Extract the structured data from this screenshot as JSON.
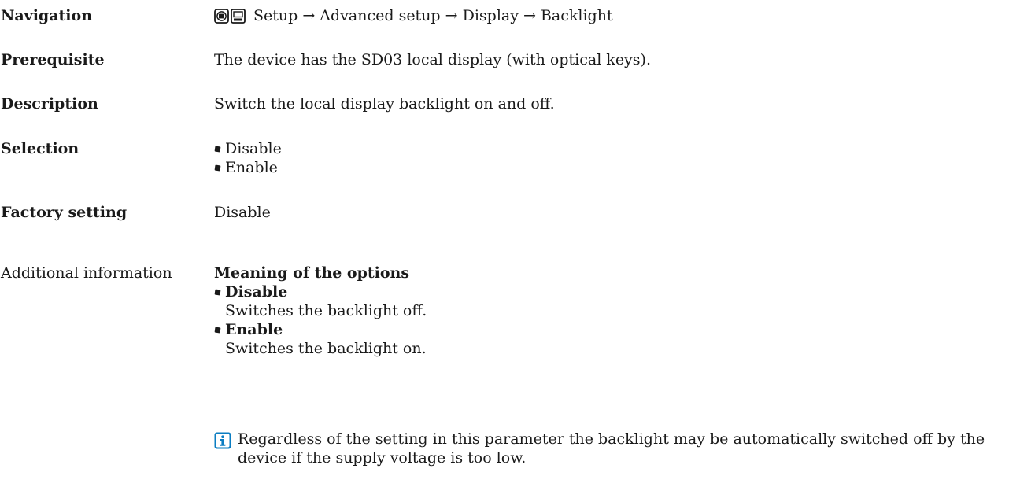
{
  "rows": {
    "navigation": {
      "label": "Navigation",
      "path": "Setup → Advanced setup → Display → Backlight",
      "icons": [
        "display-operation-icon",
        "operating-tool-icon"
      ]
    },
    "prerequisite": {
      "label": "Prerequisite",
      "text": "The device has the SD03 local display (with optical keys)."
    },
    "description": {
      "label": "Description",
      "text": "Switch the local display backlight on and off."
    },
    "selection": {
      "label": "Selection",
      "options": [
        "Disable",
        "Enable"
      ]
    },
    "factory_setting": {
      "label": "Factory setting",
      "value": "Disable"
    },
    "additional_information": {
      "label": "Additional information",
      "heading": "Meaning of the options",
      "options": [
        {
          "name": "Disable",
          "desc": "Switches the backlight off."
        },
        {
          "name": "Enable",
          "desc": "Switches the backlight on."
        }
      ],
      "note": "Regardless of the setting in this parameter the backlight may be automatically switched off by the device if the supply voltage is too low.",
      "note_icon": "info-icon",
      "note_icon_color": "#0a7dc2"
    }
  }
}
